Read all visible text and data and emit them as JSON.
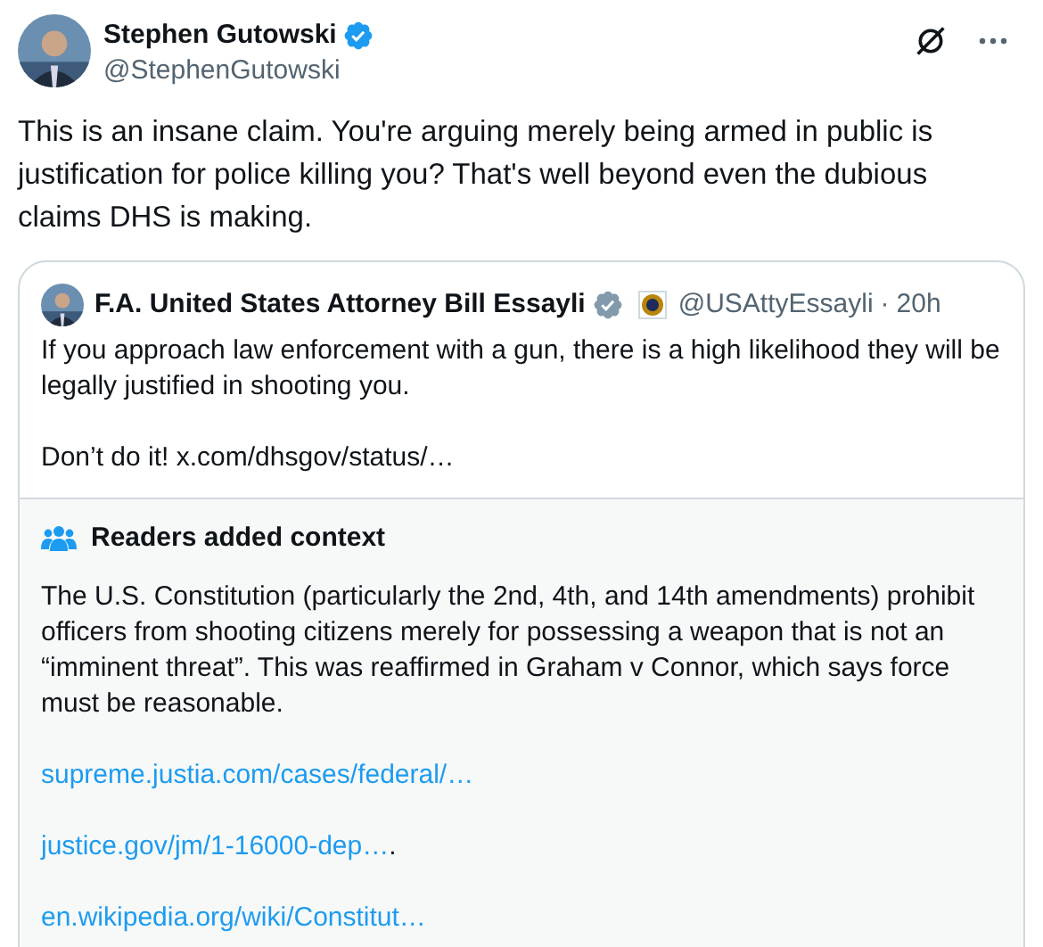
{
  "author": {
    "name": "Stephen Gutowski",
    "verified": true,
    "handle": "@StephenGutowski"
  },
  "text": "This is an insane claim. You're arguing merely being armed in public is justification for police killing you? That's well beyond even the dubious claims DHS is making.",
  "quote": {
    "name": "F.A. United States Attorney Bill Essayli",
    "verified": true,
    "handle": "@USAttyEssayli",
    "separator": "·",
    "time": "20h",
    "paragraphs": [
      "If you approach law enforcement with a gun, there is a high likelihood they will be legally justified in shooting you.",
      "Don’t do it! x.com/dhsgov/status/…"
    ]
  },
  "note": {
    "title": "Readers added context",
    "text": "The U.S. Constitution (particularly the 2nd, 4th, and 14th amendments) prohibit officers from shooting citizens merely for possessing a weapon that is not an “imminent threat”. This was reaffirmed in Graham v Connor, which says force must be reasonable.",
    "links": [
      {
        "text": "supreme.justia.com/cases/federal/…"
      },
      {
        "text": "justice.gov/jm/1-16000-dep…",
        "suffix": "."
      },
      {
        "text": "en.wikipedia.org/wiki/Constitut…"
      }
    ]
  }
}
